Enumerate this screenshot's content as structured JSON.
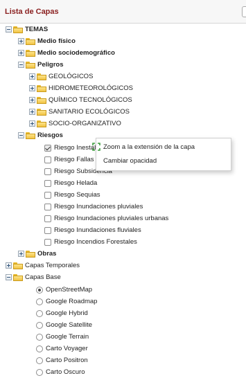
{
  "panel": {
    "title": "Lista de Capas"
  },
  "tree": {
    "temas": "TEMAS",
    "medio_fisico": "Medio físico",
    "medio_socio": "Medio sociodemográfico",
    "peligros": "Peligros",
    "geologicos": "GEOLÓGICOS",
    "hidromet": "HIDROMETEOROLÓGICOS",
    "quimico": "QUÍMICO TECNOLÓGICOS",
    "sanitario": "SANITARIO ECOLÓGICOS",
    "socio_org": "SOCIO-ORGANIZATIVO",
    "riesgos": "Riesgos",
    "riesgo_items": [
      {
        "label": "Riesgo Inestabilidad de laderas",
        "checked": true
      },
      {
        "label": "Riesgo Fallas",
        "checked": false
      },
      {
        "label": "Riesgo Subsidencia",
        "checked": false
      },
      {
        "label": "Riesgo Helada",
        "checked": false
      },
      {
        "label": "Riesgo Sequias",
        "checked": false
      },
      {
        "label": "Riesgo Inundaciones pluviales",
        "checked": false
      },
      {
        "label": "Riesgo Inundaciones pluviales urbanas",
        "checked": false
      },
      {
        "label": "Riesgo Inundaciones fluviales",
        "checked": false
      },
      {
        "label": "Riesgo Incendios Forestales",
        "checked": false
      }
    ],
    "obras": "Obras",
    "capas_temporales": "Capas Temporales",
    "capas_base": "Capas Base",
    "base_items": [
      {
        "label": "OpenStreetMap",
        "selected": true
      },
      {
        "label": "Google Roadmap",
        "selected": false
      },
      {
        "label": "Google Hybrid",
        "selected": false
      },
      {
        "label": "Google Satellite",
        "selected": false
      },
      {
        "label": "Google Terrain",
        "selected": false
      },
      {
        "label": "Carto Voyager",
        "selected": false
      },
      {
        "label": "Carto Positron",
        "selected": false
      },
      {
        "label": "Carto Oscuro",
        "selected": false
      }
    ]
  },
  "context_menu": {
    "zoom_label": "Zoom a la extensión de la capa",
    "opacity_label": "Cambiar opacidad"
  },
  "colors": {
    "title": "#8a1f1f",
    "folder": "#f1c445"
  }
}
